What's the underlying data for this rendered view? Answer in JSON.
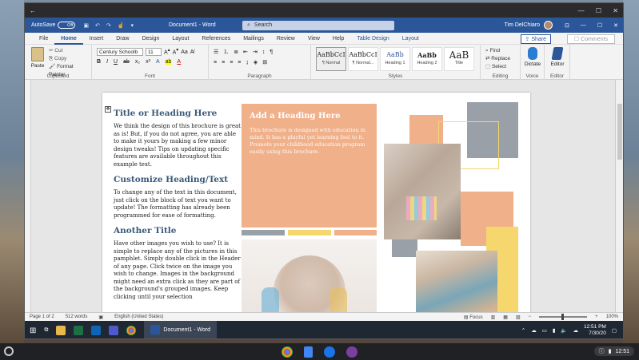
{
  "window": {
    "title": "Document1 - Word",
    "autosave_label": "AutoSave",
    "autosave_state": "Off",
    "search_placeholder": "Search",
    "user_name": "Tim DelChiaro"
  },
  "tabs": [
    "File",
    "Home",
    "Insert",
    "Draw",
    "Design",
    "Layout",
    "References",
    "Mailings",
    "Review",
    "View",
    "Help",
    "Table Design",
    "Layout"
  ],
  "share_label": "Share",
  "comments_label": "Comments",
  "ribbon": {
    "clipboard": {
      "label": "Clipboard",
      "paste": "Paste",
      "cut": "Cut",
      "copy": "Copy",
      "format_painter": "Format Painter"
    },
    "font": {
      "label": "Font",
      "font_name": "Century Schoolb",
      "font_size": "11"
    },
    "paragraph": {
      "label": "Paragraph"
    },
    "styles": {
      "label": "Styles",
      "items": [
        {
          "preview": "AaBbCcI",
          "name": "¶ Normal"
        },
        {
          "preview": "AaBbCcI",
          "name": "¶ Normal..."
        },
        {
          "preview": "AaBb",
          "name": "Heading 1"
        },
        {
          "preview": "AaBb",
          "name": "Heading 2"
        },
        {
          "preview": "AaB",
          "name": "Title"
        }
      ]
    },
    "editing": {
      "label": "Editing",
      "find": "Find",
      "replace": "Replace",
      "select": "Select"
    },
    "voice": {
      "label": "Voice",
      "dictate": "Dictate"
    },
    "editor": {
      "label": "Editor",
      "editor": "Editor"
    }
  },
  "document": {
    "col1": {
      "h1": "Title or Heading Here",
      "p1": "We think the design of this brochure is great as is! But, if you do not agree, you are able to make it yours by making a few minor design tweaks! Tips on updating specific features are available throughout this example text.",
      "h2": "Customize Heading/Text",
      "p2": "To change any of the text in this document, just click on the block of text you want to update! The formatting has already been programmed for ease of formatting.",
      "h3": "Another Title",
      "p3": "Have other images you wish to use? It is simple to replace any of the pictures in this pamphlet. Simply double click in the Header of any page. Click twice on the image you wish to change. Images in the background might need an extra click as they are part of the background's grouped images. Keep clicking until your selection"
    },
    "orange": {
      "heading": "Add a Heading Here",
      "body": "This brochure is designed with education in mind. It has a playful yet learning feel to it. Promote your childhood education program easily using this brochure."
    }
  },
  "status": {
    "page": "Page 1 of 2",
    "words": "512 words",
    "language": "English (United States)",
    "focus": "Focus",
    "zoom": "100%"
  },
  "taskbar": {
    "word_label": "Document1 - Word",
    "time": "12:51 PM",
    "date": "7/30/20"
  },
  "shelf": {
    "time": "12:51"
  },
  "colors": {
    "word_blue": "#2b579a",
    "orange": "#f0b08a",
    "slate": "#9aa0a8",
    "yellow": "#f5d76e"
  }
}
